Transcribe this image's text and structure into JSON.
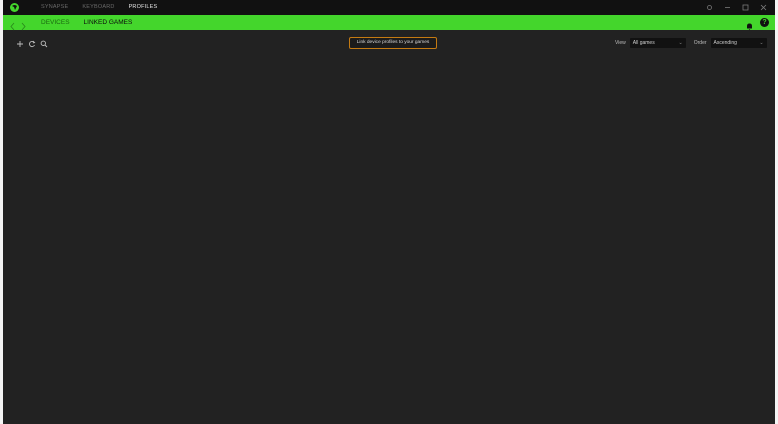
{
  "app": {
    "top_tabs": [
      {
        "label": "SYNAPSE",
        "active": false
      },
      {
        "label": "KEYBOARD",
        "active": false
      },
      {
        "label": "PROFILES",
        "active": true
      }
    ],
    "sub_tabs": [
      {
        "label": "DEVICES",
        "active": false
      },
      {
        "label": "LINKED GAMES",
        "active": true
      }
    ],
    "help_glyph": "?"
  },
  "toolbar": {
    "icons": [
      "add-icon",
      "refresh-icon",
      "search-icon"
    ],
    "hint": "Link device profiles to your games"
  },
  "filters": {
    "view_label": "View",
    "view_value": "All games",
    "order_label": "Order",
    "order_value": "Ascending"
  },
  "colors": {
    "accent": "#44d62c",
    "titlebar": "#111111",
    "background": "#222222",
    "hint_border": "#c47a12"
  }
}
